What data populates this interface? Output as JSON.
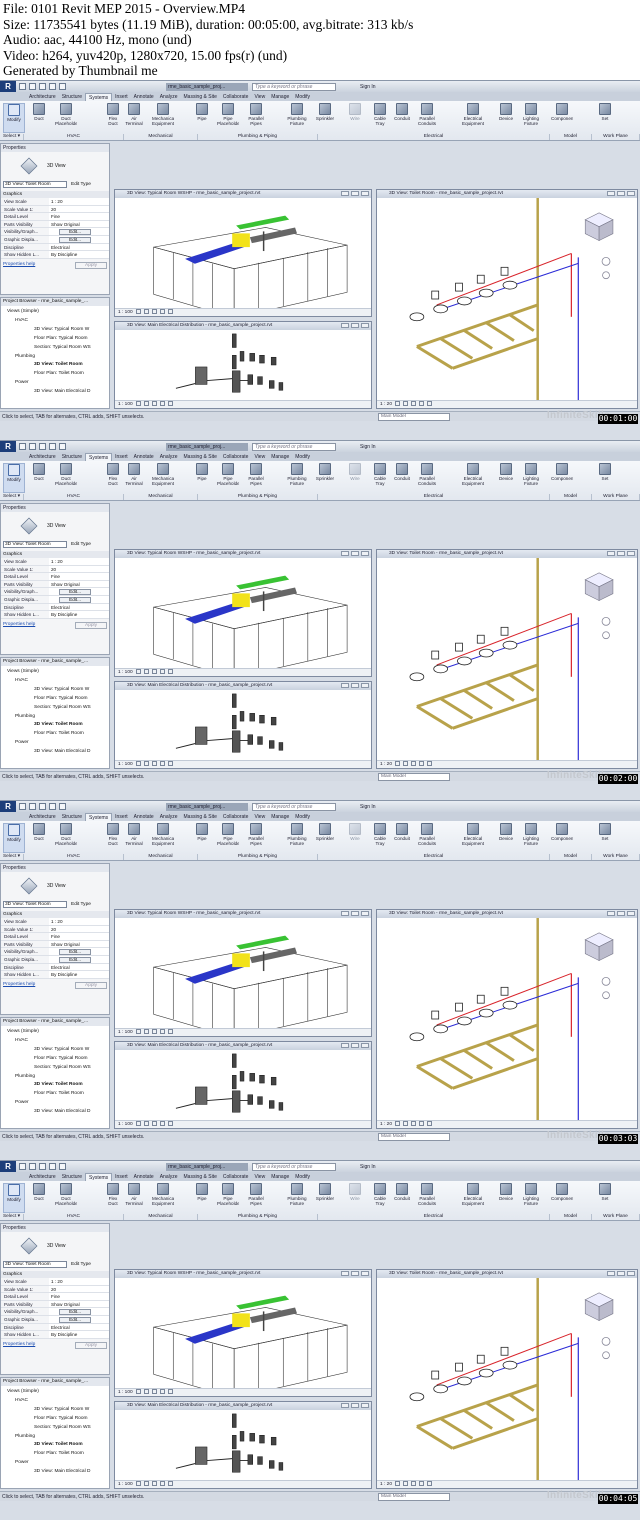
{
  "header": {
    "file": "File: 0101 Revit MEP 2015 - Overview.MP4",
    "size": "Size: 11735541 bytes (11.19 MiB), duration: 00:05:00, avg.bitrate: 313 kb/s",
    "audio": "Audio: aac, 44100 Hz, mono (und)",
    "video": "Video: h264, yuv420p, 1280x720, 15.00 fps(r) (und)",
    "generator": "Generated by Thumbnail me"
  },
  "app": {
    "doc_tab": "rme_basic_sample_proj...",
    "search_placeholder": "Type a keyword or phrase",
    "sign_in": "Sign In"
  },
  "ribbon_tabs": [
    "Architecture",
    "Structure",
    "Systems",
    "Insert",
    "Annotate",
    "Analyze",
    "Massing & Site",
    "Collaborate",
    "View",
    "Manage",
    "Modify"
  ],
  "active_tab": "Systems",
  "ribbon_buttons": [
    {
      "label": "Modify",
      "icon": "cursor-icon"
    },
    {
      "label": "Duct",
      "icon": "duct-icon"
    },
    {
      "label": "Duct\nPlaceholder",
      "icon": "duct-placeholder-icon"
    },
    {
      "label": "Flex\nDuct",
      "icon": "flex-duct-icon"
    },
    {
      "label": "Air\nTerminal",
      "icon": "air-terminal-icon"
    },
    {
      "label": "Mechanical\nEquipment",
      "icon": "mechanical-equipment-icon"
    },
    {
      "label": "Pipe",
      "icon": "pipe-icon"
    },
    {
      "label": "Pipe\nPlaceholder",
      "icon": "pipe-placeholder-icon"
    },
    {
      "label": "Parallel\nPipes",
      "icon": "parallel-pipes-icon"
    },
    {
      "label": "Plumbing\nFixture",
      "icon": "plumbing-fixture-icon"
    },
    {
      "label": "Sprinkler",
      "icon": "sprinkler-icon"
    },
    {
      "label": "Wire",
      "icon": "wire-icon"
    },
    {
      "label": "Cable\nTray",
      "icon": "cable-tray-icon"
    },
    {
      "label": "Conduit",
      "icon": "conduit-icon"
    },
    {
      "label": "Parallel\nConduits",
      "icon": "parallel-conduits-icon"
    },
    {
      "label": "Electrical\nEquipment",
      "icon": "electrical-equipment-icon"
    },
    {
      "label": "Device",
      "icon": "device-icon"
    },
    {
      "label": "Lighting\nFixture",
      "icon": "lighting-fixture-icon"
    },
    {
      "label": "Component",
      "icon": "component-icon"
    },
    {
      "label": "Set",
      "icon": "set-icon"
    }
  ],
  "ribbon_panels": [
    "Select ▾",
    "HVAC",
    "Mechanical",
    "Plumbing & Piping",
    "Electrical",
    "Model",
    "Work Plane"
  ],
  "properties": {
    "title": "Properties",
    "type_name": "3D View",
    "selector": "3D View: Toilet Room",
    "edit_type": "Edit Type",
    "group": "Graphics",
    "rows": [
      {
        "k": "View Scale",
        "v": "1 : 20"
      },
      {
        "k": "Scale Value 1:",
        "v": "20"
      },
      {
        "k": "Detail Level",
        "v": "Fine"
      },
      {
        "k": "Parts Visibility",
        "v": "Show Original"
      },
      {
        "k": "Visibility/Graph...",
        "v": "Edit..."
      },
      {
        "k": "Graphic Displa...",
        "v": "Edit..."
      },
      {
        "k": "Discipline",
        "v": "Electrical"
      },
      {
        "k": "Show Hidden L...",
        "v": "By Discipline"
      }
    ],
    "help": "Properties help",
    "apply": "Apply"
  },
  "browser": {
    "title": "Project Browser - rme_basic_sample_...",
    "items": [
      {
        "label": "Views (Simple)",
        "level": 1,
        "bold": false
      },
      {
        "label": "HVAC",
        "level": 2,
        "bold": false
      },
      {
        "label": "3D View: Typical Room W",
        "level": 3,
        "bold": false
      },
      {
        "label": "Floor Plan: Typical Room",
        "level": 3,
        "bold": false
      },
      {
        "label": "Section: Typical Room WS",
        "level": 3,
        "bold": false
      },
      {
        "label": "Plumbing",
        "level": 2,
        "bold": false
      },
      {
        "label": "3D View: Toilet Room",
        "level": 3,
        "bold": true
      },
      {
        "label": "Floor Plan: Toilet Room",
        "level": 3,
        "bold": false
      },
      {
        "label": "Power",
        "level": 2,
        "bold": false
      },
      {
        "label": "3D View: Main Electrical D",
        "level": 3,
        "bold": false
      }
    ]
  },
  "views": {
    "typical": "3D View: Typical Room WSHP - rme_basic_sample_project.rvt",
    "electrical": "3D View: Main Electrical Distribution - rme_basic_sample_project.rvt",
    "toilet": "3D View: Toilet Room - rme_basic_sample_project.rvt",
    "scale_100": "1 : 100",
    "scale_20": "1 : 20"
  },
  "status": {
    "text": "Click to select, TAB for alternates, CTRL adds, SHIFT unselects.",
    "model": "Main Model",
    "watermark": "InfiniteSkills"
  },
  "frames": [
    {
      "timestamp": "00:01:00"
    },
    {
      "timestamp": "00:02:00"
    },
    {
      "timestamp": "00:03:03"
    },
    {
      "timestamp": "00:04:05"
    }
  ],
  "colors": {
    "duct_blue": "#2a36c8",
    "equipment_yellow": "#f2e21a",
    "pipe_green": "#39c233",
    "pipe_olive": "#b8a24a",
    "supply_blue": "#2b2bd6",
    "hot_red": "#d8232a"
  }
}
